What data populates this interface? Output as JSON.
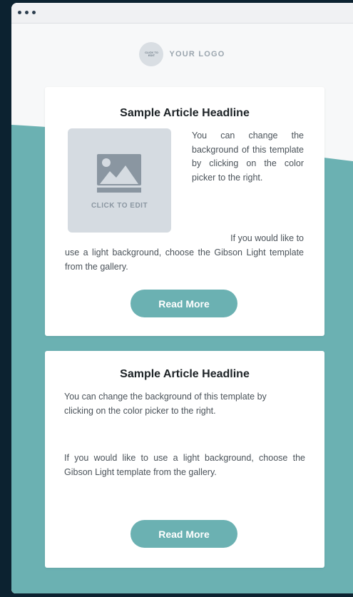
{
  "logo": {
    "badge_text": "CLICK TO EDIT",
    "text": "YOUR LOGO"
  },
  "colors": {
    "teal": "#6bb1b2",
    "dark_frame": "#0c2230",
    "card": "#ffffff",
    "placeholder": "#d5dbe1"
  },
  "articles": [
    {
      "headline": "Sample Article Headline",
      "image_label": "CLICK TO EDIT",
      "image_icon": "image-placeholder-icon",
      "paragraph1": "You can change the background of this template by clicking on the color picker to the right.",
      "paragraph2_start": "If you would like to",
      "paragraph2_rest": "use a light background, choose the Gibson Light template from the gallery.",
      "button": "Read More"
    },
    {
      "headline": "Sample Article Headline",
      "paragraph1": "You can change the background of this template by clicking on the color picker to the right.",
      "paragraph2": "If you would like to use a light background, choose the Gibson Light template from the gallery.",
      "button": "Read More"
    }
  ]
}
